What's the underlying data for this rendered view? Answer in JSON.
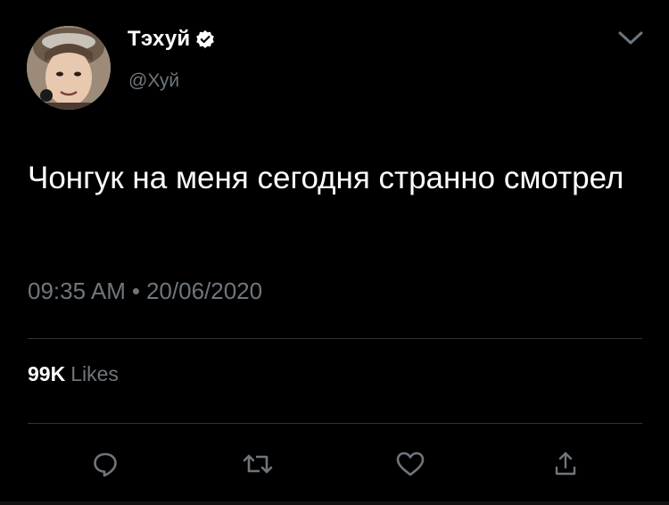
{
  "user": {
    "display_name": "Тэхуй",
    "handle": "@Хуй"
  },
  "tweet": {
    "text": "Чонгук на меня сегодня странно смотрел",
    "time": "09:35 AM",
    "separator": "•",
    "date": "20/06/2020"
  },
  "stats": {
    "likes_count": "99K",
    "likes_label": "Likes"
  },
  "actions": [
    {
      "icon": "reply-icon"
    },
    {
      "icon": "retweet-icon"
    },
    {
      "icon": "like-icon"
    },
    {
      "icon": "share-icon"
    }
  ],
  "colors": {
    "background": "#000000",
    "text": "#ffffff",
    "secondary": "#6e767d",
    "divider": "#2f3336"
  }
}
